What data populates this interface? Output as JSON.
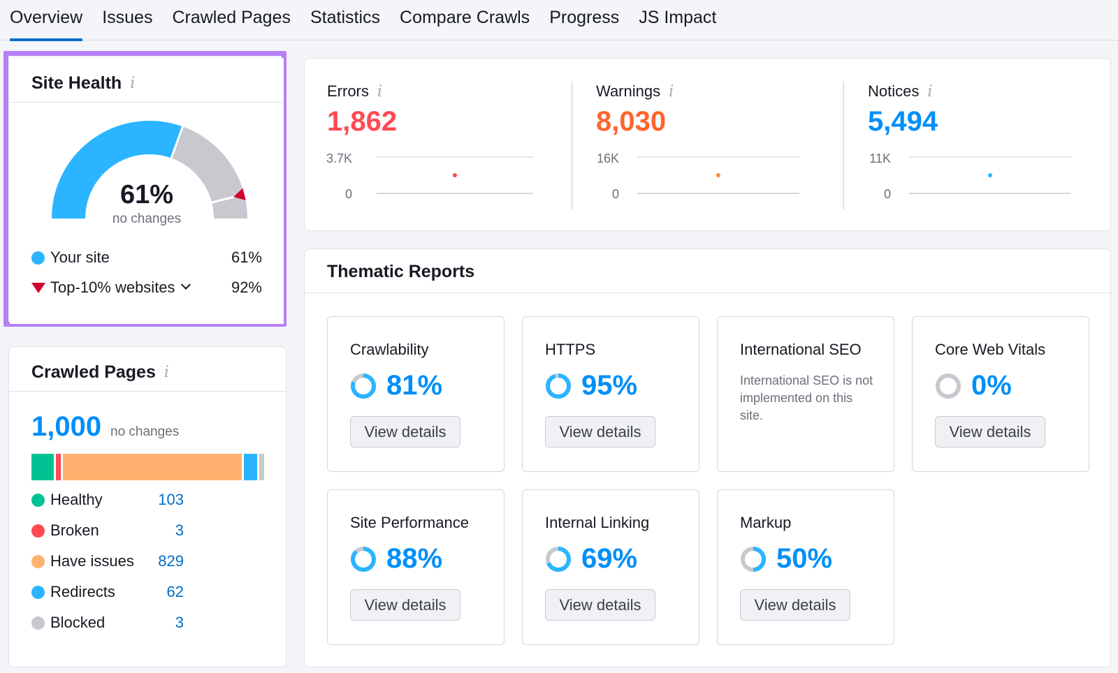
{
  "tabs": [
    {
      "label": "Overview",
      "active": true
    },
    {
      "label": "Issues"
    },
    {
      "label": "Crawled Pages"
    },
    {
      "label": "Statistics"
    },
    {
      "label": "Compare Crawls"
    },
    {
      "label": "Progress"
    },
    {
      "label": "JS Impact"
    }
  ],
  "info_glyph": "i",
  "site_health": {
    "title": "Site Health",
    "value": "61%",
    "value_fraction": 0.61,
    "top10_fraction": 0.92,
    "subtitle": "no changes",
    "colors": {
      "your_site": "#2bb4ff",
      "remainder": "#c7c9cf",
      "marker": "#d1002f"
    },
    "legend": [
      {
        "label": "Your site",
        "value": "61%"
      },
      {
        "label": "Top-10% websites",
        "value": "92%"
      }
    ]
  },
  "crawled_pages": {
    "title": "Crawled Pages",
    "total": "1,000",
    "total_sub": "no changes",
    "rows": [
      {
        "label": "Healthy",
        "value": "103",
        "count": 103,
        "color": "#00c292"
      },
      {
        "label": "Broken",
        "value": "3",
        "count": 3,
        "color": "#ff4953"
      },
      {
        "label": "Have issues",
        "value": "829",
        "count": 829,
        "color": "#ffb26f"
      },
      {
        "label": "Redirects",
        "value": "62",
        "count": 62,
        "color": "#2bb4ff"
      },
      {
        "label": "Blocked",
        "value": "3",
        "count": 3,
        "color": "#c7c9cf"
      }
    ]
  },
  "issues": [
    {
      "label": "Errors",
      "value": "1,862",
      "color": "#ff4953",
      "max": "3.7K",
      "min": "0",
      "dot_color": "#ff4953"
    },
    {
      "label": "Warnings",
      "value": "8,030",
      "color": "#ff642d",
      "max": "16K",
      "min": "0",
      "dot_color": "#ff8c3d"
    },
    {
      "label": "Notices",
      "value": "5,494",
      "color": "#008ff8",
      "max": "11K",
      "min": "0",
      "dot_color": "#2bb4ff"
    }
  ],
  "thematic": {
    "title": "Thematic Reports",
    "button_label": "View details",
    "reports": [
      {
        "name": "Crawlability",
        "score": "81%",
        "fraction": 0.81
      },
      {
        "name": "HTTPS",
        "score": "95%",
        "fraction": 0.95
      },
      {
        "name": "International SEO",
        "note": "International SEO is not implemented on this site."
      },
      {
        "name": "Core Web Vitals",
        "score": "0%",
        "fraction": 0
      },
      {
        "name": "Site Performance",
        "score": "88%",
        "fraction": 0.88
      },
      {
        "name": "Internal Linking",
        "score": "69%",
        "fraction": 0.69
      },
      {
        "name": "Markup",
        "score": "50%",
        "fraction": 0.5
      }
    ]
  }
}
